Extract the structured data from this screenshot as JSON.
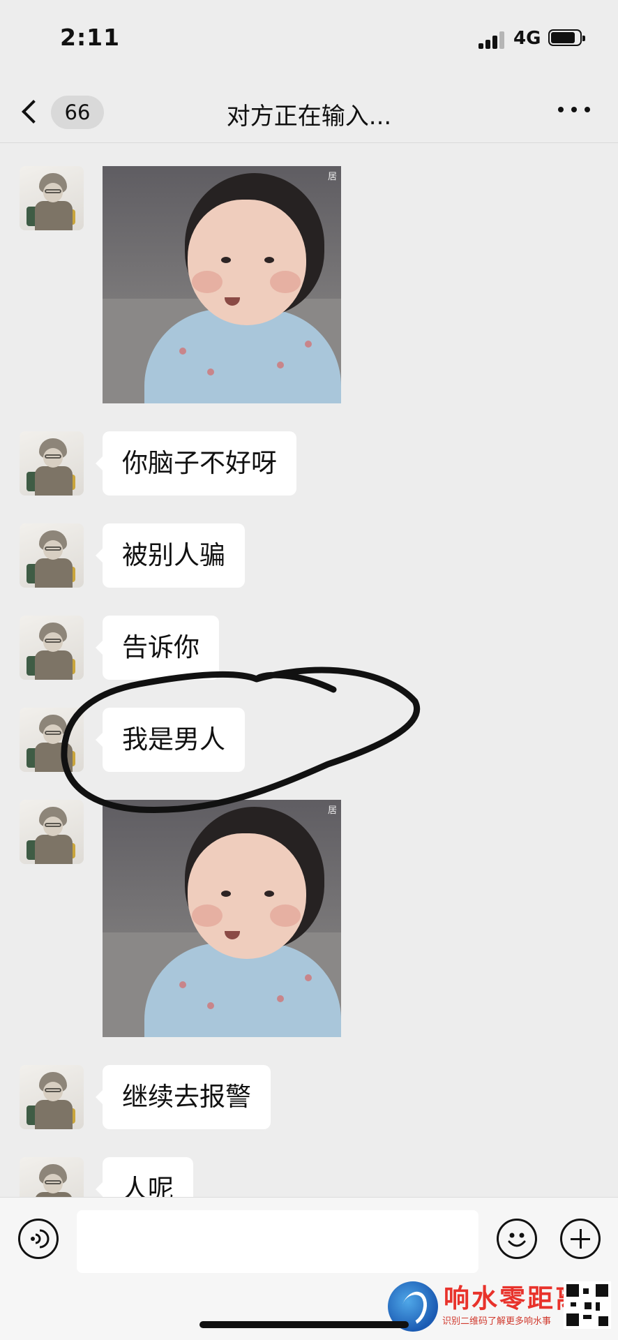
{
  "status_bar": {
    "time": "2:11",
    "network": "4G",
    "icons": [
      "signal-icon",
      "battery-icon"
    ]
  },
  "nav": {
    "back_icon": "chevron-left-icon",
    "unread_count": "66",
    "title": "对方正在输入...",
    "more_icon": "more-dots-icon"
  },
  "messages": [
    {
      "type": "sticker",
      "sender": "other",
      "mark": "居"
    },
    {
      "type": "text",
      "sender": "other",
      "text": "你脑子不好呀"
    },
    {
      "type": "text",
      "sender": "other",
      "text": "被别人骗"
    },
    {
      "type": "text",
      "sender": "other",
      "text": "告诉你"
    },
    {
      "type": "text",
      "sender": "other",
      "text": "我是男人",
      "annotated": true
    },
    {
      "type": "sticker",
      "sender": "other",
      "mark": "居"
    },
    {
      "type": "text",
      "sender": "other",
      "text": "继续去报警"
    },
    {
      "type": "text",
      "sender": "other",
      "text": "人呢"
    }
  ],
  "input_bar": {
    "voice_icon": "voice-icon",
    "input_value": "",
    "emoji_icon": "emoji-icon",
    "plus_icon": "plus-icon"
  },
  "watermark": {
    "title": "响水零距离",
    "subtitle": "识别二维码了解更多响水事",
    "logo_icon": "logo-icon",
    "qr_icon": "qr-code-icon"
  },
  "colors": {
    "background": "#ededed",
    "bubble": "#ffffff",
    "annotation": "#111111",
    "watermark_red": "#e8322b"
  }
}
